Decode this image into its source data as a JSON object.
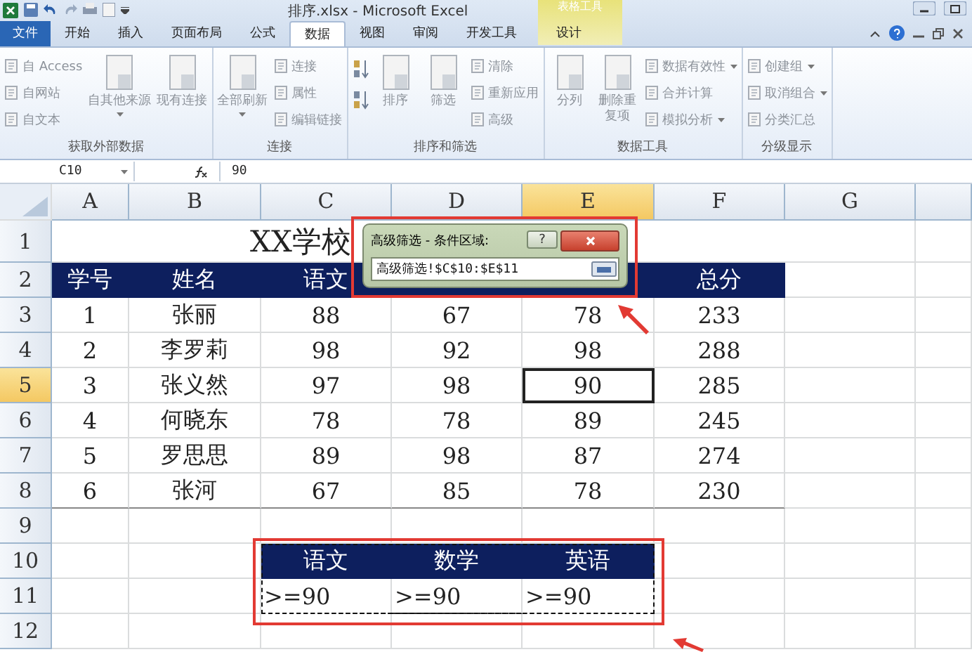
{
  "window": {
    "title": "排序.xlsx - Microsoft Excel",
    "context_tab_group": "表格工具"
  },
  "tabs": [
    {
      "label": "文件",
      "kind": "file",
      "selected": false
    },
    {
      "label": "开始",
      "kind": "tab",
      "selected": false
    },
    {
      "label": "插入",
      "kind": "tab",
      "selected": false
    },
    {
      "label": "页面布局",
      "kind": "tab",
      "selected": false
    },
    {
      "label": "公式",
      "kind": "tab",
      "selected": false
    },
    {
      "label": "数据",
      "kind": "tab",
      "selected": true
    },
    {
      "label": "视图",
      "kind": "tab",
      "selected": false
    },
    {
      "label": "审阅",
      "kind": "tab",
      "selected": false
    },
    {
      "label": "开发工具",
      "kind": "tab",
      "selected": false
    },
    {
      "label": "设计",
      "kind": "context",
      "selected": false
    }
  ],
  "ribbon": [
    {
      "label": "获取外部数据",
      "items": [
        {
          "kind": "small",
          "label": "自 Access"
        },
        {
          "kind": "small",
          "label": "自网站"
        },
        {
          "kind": "small",
          "label": "自文本"
        },
        {
          "kind": "large",
          "label": "自其他来源",
          "menu": true
        },
        {
          "kind": "large",
          "label": "现有连接"
        }
      ]
    },
    {
      "label": "连接",
      "items": [
        {
          "kind": "large",
          "label": "全部刷新",
          "menu": true
        },
        {
          "kind": "small",
          "label": "连接"
        },
        {
          "kind": "small",
          "label": "属性"
        },
        {
          "kind": "small",
          "label": "编辑链接"
        }
      ]
    },
    {
      "label": "排序和筛选",
      "items": [
        {
          "kind": "sortpair"
        },
        {
          "kind": "large",
          "label": "排序"
        },
        {
          "kind": "large",
          "label": "筛选"
        },
        {
          "kind": "small",
          "label": "清除"
        },
        {
          "kind": "small",
          "label": "重新应用"
        },
        {
          "kind": "small",
          "label": "高级"
        }
      ]
    },
    {
      "label": "数据工具",
      "items": [
        {
          "kind": "large",
          "label": "分列"
        },
        {
          "kind": "tall",
          "label": "删除重复项"
        },
        {
          "kind": "small",
          "label": "数据有效性",
          "menu": true
        },
        {
          "kind": "small",
          "label": "合并计算"
        },
        {
          "kind": "small",
          "label": "模拟分析",
          "menu": true
        }
      ]
    },
    {
      "label": "分级显示",
      "items": [
        {
          "kind": "small",
          "label": "创建组",
          "menu": true
        },
        {
          "kind": "small",
          "label": "取消组合",
          "menu": true
        },
        {
          "kind": "small",
          "label": "分类汇总"
        }
      ]
    }
  ],
  "formula_bar": {
    "name_box": "C10",
    "formula": "90"
  },
  "sheet": {
    "columns": [
      {
        "label": "A",
        "selected": false
      },
      {
        "label": "B",
        "selected": false
      },
      {
        "label": "C",
        "selected": false
      },
      {
        "label": "D",
        "selected": false
      },
      {
        "label": "E",
        "selected": true
      },
      {
        "label": "F",
        "selected": false
      },
      {
        "label": "G",
        "selected": false
      }
    ],
    "title_row": {
      "number": "1",
      "selected": false,
      "text": "XX学校"
    },
    "header_row": {
      "number": "2",
      "selected": false,
      "cells": [
        {
          "text": "学号"
        },
        {
          "text": "姓名"
        },
        {
          "text": "语文"
        },
        {},
        {},
        {
          "text": "总分"
        }
      ]
    },
    "rows": [
      {
        "number": "3",
        "selected": false,
        "cells": [
          "1",
          "张丽",
          "88",
          "67",
          "78",
          "233"
        ]
      },
      {
        "number": "4",
        "selected": false,
        "cells": [
          "2",
          "李罗莉",
          "98",
          "92",
          "98",
          "288"
        ]
      },
      {
        "number": "5",
        "selected": true,
        "cells": [
          "3",
          "张义然",
          "97",
          "98",
          "90",
          "285"
        ]
      },
      {
        "number": "6",
        "selected": false,
        "cells": [
          "4",
          "何晓东",
          "78",
          "78",
          "89",
          "245"
        ]
      },
      {
        "number": "7",
        "selected": false,
        "cells": [
          "5",
          "罗思思",
          "89",
          "98",
          "87",
          "274"
        ]
      },
      {
        "number": "8",
        "selected": false,
        "cells": [
          "6",
          "张河",
          "67",
          "85",
          "78",
          "230"
        ]
      }
    ],
    "blank_row": {
      "number": "9",
      "selected": false
    },
    "criteria": {
      "header": {
        "number": "10",
        "selected": false,
        "cells": [
          "语文",
          "数学",
          "英语"
        ]
      },
      "values": {
        "number": "11",
        "selected": false,
        "cells": [
          ">=90",
          ">=90",
          ">=90"
        ]
      }
    },
    "last_row": {
      "number": "12",
      "selected": false
    }
  },
  "dialog": {
    "title": "高级筛选 - 条件区域:",
    "help": "?",
    "range": "高级筛选!$C$10:$E$11"
  }
}
